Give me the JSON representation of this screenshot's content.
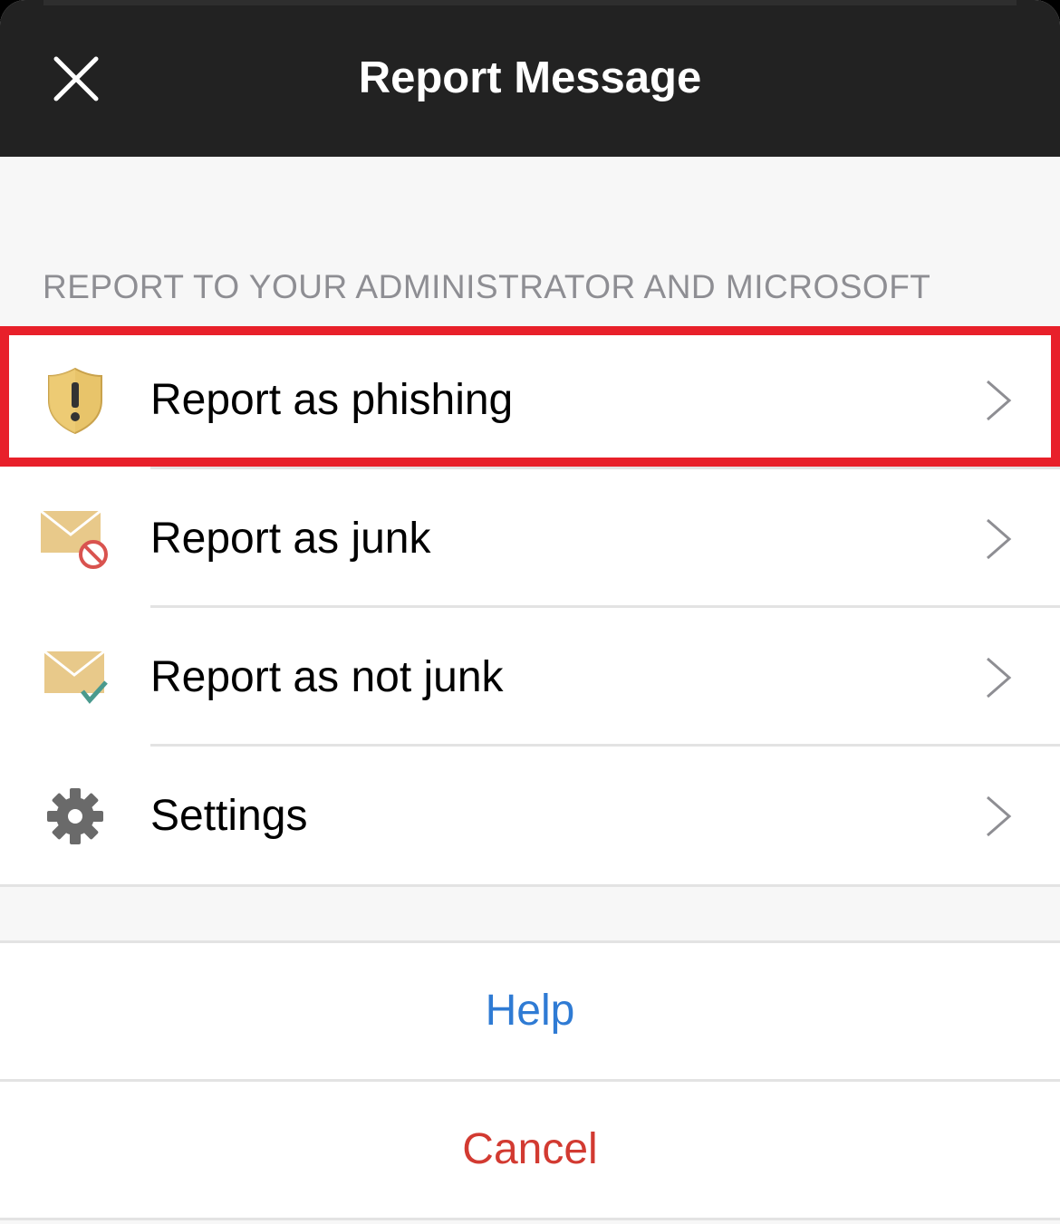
{
  "header": {
    "title": "Report Message",
    "close_icon": "close-icon"
  },
  "section": {
    "header": "REPORT TO YOUR ADMINISTRATOR AND MICROSOFT"
  },
  "items": [
    {
      "label": "Report as phishing",
      "icon": "shield-warning-icon",
      "highlighted": true
    },
    {
      "label": "Report as junk",
      "icon": "envelope-blocked-icon"
    },
    {
      "label": "Report as not junk",
      "icon": "envelope-check-icon"
    },
    {
      "label": "Settings",
      "icon": "gear-icon"
    }
  ],
  "actions": {
    "help_label": "Help",
    "cancel_label": "Cancel"
  },
  "colors": {
    "header_bg": "#222222",
    "highlight": "#e8202a",
    "help": "#2f7bd4",
    "cancel": "#d23a31",
    "shield": "#e8c46a",
    "envelope": "#e8c98a"
  }
}
